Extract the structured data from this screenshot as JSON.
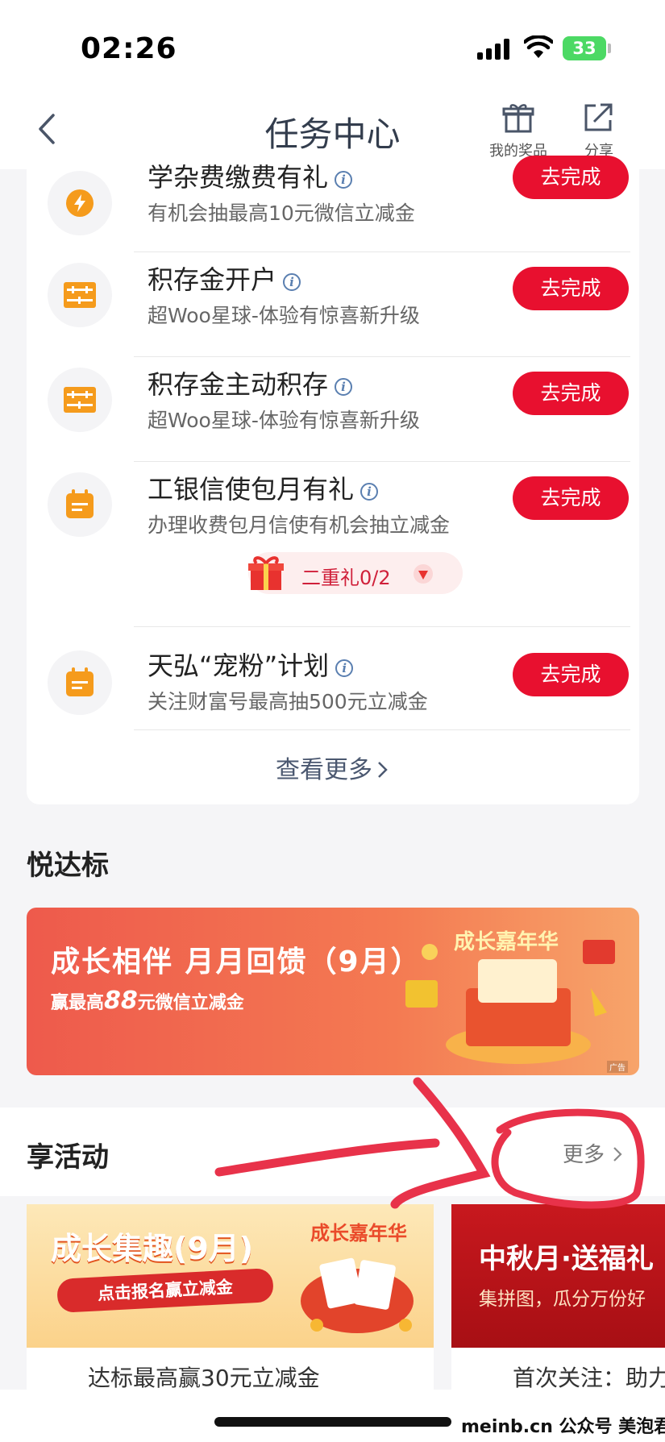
{
  "status_bar": {
    "time": "02:26",
    "battery": "33"
  },
  "nav": {
    "title": "任务中心",
    "prize_label": "我的奖品",
    "share_label": "分享"
  },
  "tasks": [
    {
      "title": "学杂费缴费有礼",
      "subtitle": "有机会抽最高10元微信立减金",
      "button": "去完成",
      "icon": "flame-icon"
    },
    {
      "title": "积存金开户",
      "subtitle": "超Woo星球-体验有惊喜新升级",
      "button": "去完成",
      "icon": "abacus-icon"
    },
    {
      "title": "积存金主动积存",
      "subtitle": "超Woo星球-体验有惊喜新升级",
      "button": "去完成",
      "icon": "abacus-icon"
    },
    {
      "title": "工银信使包月有礼",
      "subtitle": "办理收费包月信使有机会抽立减金",
      "button": "去完成",
      "icon": "calendar-icon"
    },
    {
      "title": "天弘“宠粉”计划",
      "subtitle": "关注财富号最高抽500元立减金",
      "button": "去完成",
      "icon": "calendar-icon"
    }
  ],
  "bonus": {
    "label": "二重礼0/2"
  },
  "view_more": "查看更多",
  "section_yue": {
    "title": "悦达标"
  },
  "banner": {
    "title": "成长相伴 月月回馈（9月）",
    "sub_prefix": "赢最高",
    "sub_amount": "88",
    "sub_suffix": "元微信立减金",
    "badge": "成长嘉年华",
    "ad": "广告"
  },
  "section_xiang": {
    "title": "享活动",
    "more": "更多"
  },
  "activities": [
    {
      "title": "成长集趣(9月)",
      "pill": "点击报名赢立减金",
      "badge": "成长嘉年华",
      "desc": "达标最高赢30元立减金"
    },
    {
      "title": "中秋月·送福礼",
      "subtitle": "集拼图，瓜分万份好",
      "desc": "首次关注：助力"
    }
  ],
  "watermark": "meinb.cn  公众号 美泡君"
}
